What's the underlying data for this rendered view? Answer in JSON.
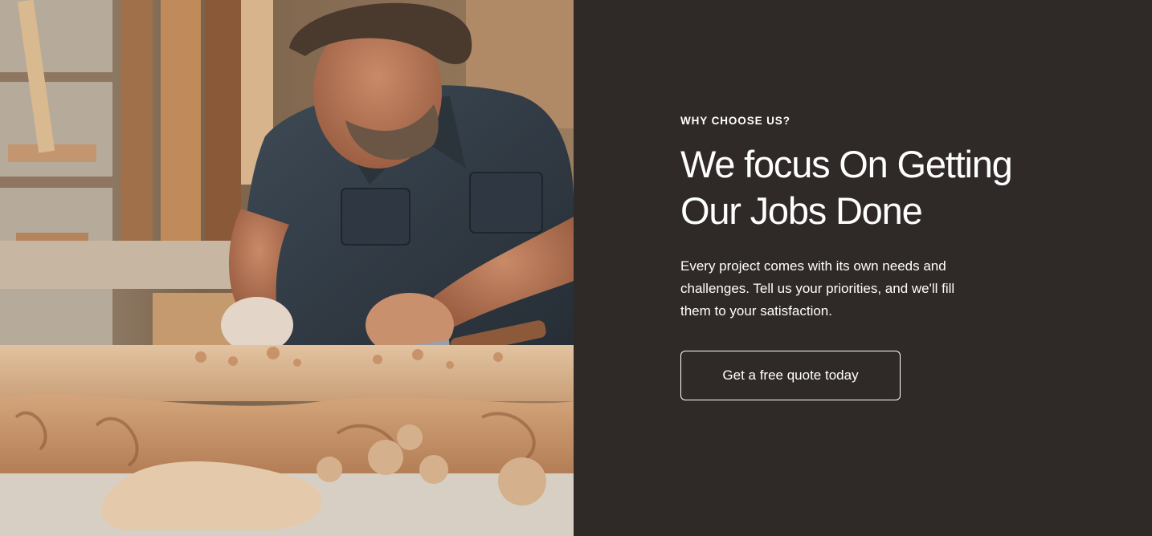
{
  "photo": {
    "subject": "Craftsman carving wood at a workbench"
  },
  "content": {
    "eyebrow": "WHY CHOOSE US?",
    "heading_line1": "We focus On Getting",
    "heading_line2": "Our Jobs Done",
    "body": "Every project comes with its own needs and challenges. Tell us your priorities, and we'll fill them to your satisfaction.",
    "cta_label": "Get a free quote today"
  },
  "colors": {
    "panel_background": "#2f2927",
    "text": "#ffffff",
    "button_border": "#ffffff"
  }
}
